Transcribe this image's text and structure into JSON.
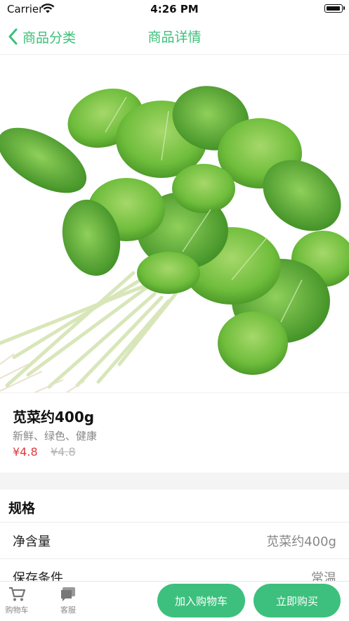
{
  "status_bar": {
    "carrier": "Carrier",
    "time": "4:26 PM"
  },
  "nav": {
    "back_label": "商品分类",
    "title": "商品详情"
  },
  "product": {
    "image": "product-photo (green amaranth bundle)",
    "name": "苋菜约400g",
    "tags": "新鲜、绿色、健康",
    "price": "¥4.8",
    "original_price": "¥4.8"
  },
  "spec": {
    "title": "规格",
    "rows": [
      {
        "key": "净含量",
        "value": "苋菜约400g"
      },
      {
        "key": "保存条件",
        "value": "常温"
      }
    ]
  },
  "bottom_bar": {
    "cart_label": "购物车",
    "service_label": "客服",
    "add_to_cart": "加入购物车",
    "buy_now": "立即购买"
  },
  "colors": {
    "accent": "#3dc07d",
    "price": "#e03b3b",
    "muted": "#888888"
  }
}
